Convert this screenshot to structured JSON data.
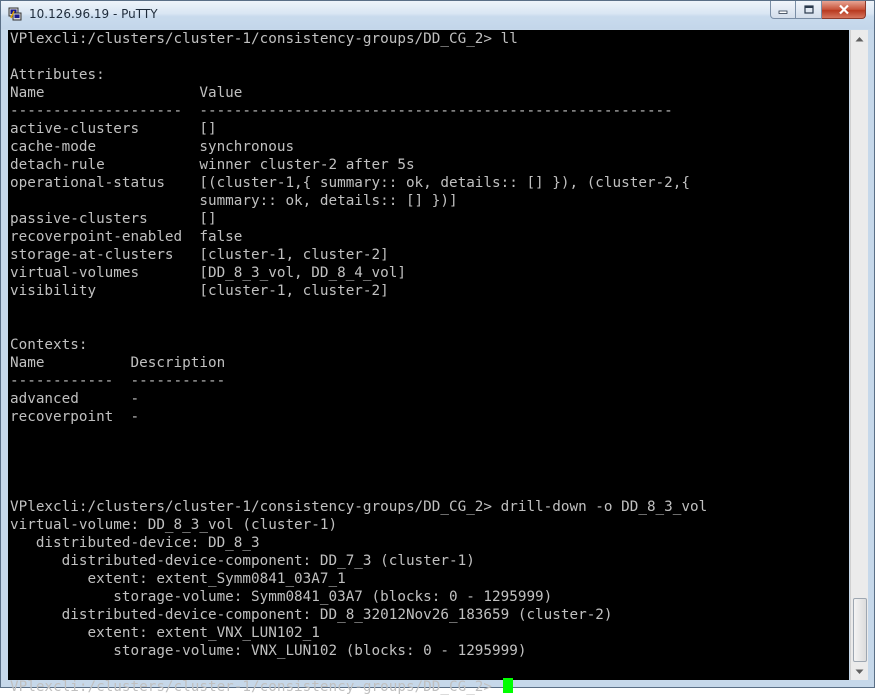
{
  "window": {
    "title": "10.126.96.19 - PuTTY",
    "icons": {
      "app": "putty-icon",
      "minimize": "minimize-icon",
      "maximize": "maximize-icon",
      "close": "close-icon"
    }
  },
  "terminal": {
    "colors": {
      "background": "#000000",
      "text": "#c0c0c0",
      "cursor": "#00ff00"
    },
    "lines": [
      "VPlexcli:/clusters/cluster-1/consistency-groups/DD_CG_2> ll",
      "",
      "Attributes:",
      "Name                  Value",
      "--------------------  -------------------------------------------------------",
      "active-clusters       []",
      "cache-mode            synchronous",
      "detach-rule           winner cluster-2 after 5s",
      "operational-status    [(cluster-1,{ summary:: ok, details:: [] }), (cluster-2,{",
      "                      summary:: ok, details:: [] })]",
      "passive-clusters      []",
      "recoverpoint-enabled  false",
      "storage-at-clusters   [cluster-1, cluster-2]",
      "virtual-volumes       [DD_8_3_vol, DD_8_4_vol]",
      "visibility            [cluster-1, cluster-2]",
      "",
      "",
      "Contexts:",
      "Name          Description",
      "------------  -----------",
      "advanced      -",
      "recoverpoint  -",
      "",
      "",
      "",
      "",
      "VPlexcli:/clusters/cluster-1/consistency-groups/DD_CG_2> drill-down -o DD_8_3_vol",
      "virtual-volume: DD_8_3_vol (cluster-1)",
      "   distributed-device: DD_8_3",
      "      distributed-device-component: DD_7_3 (cluster-1)",
      "         extent: extent_Symm0841_03A7_1",
      "            storage-volume: Symm0841_03A7 (blocks: 0 - 1295999)",
      "      distributed-device-component: DD_8_32012Nov26_183659 (cluster-2)",
      "         extent: extent_VNX_LUN102_1",
      "            storage-volume: VNX_LUN102 (blocks: 0 - 1295999)",
      ""
    ],
    "prompt": "VPlexcli:/clusters/cluster-1/consistency-groups/DD_CG_2> "
  },
  "scrollbar": {
    "icons": {
      "up": "arrow-up-icon",
      "down": "arrow-down-icon"
    }
  }
}
